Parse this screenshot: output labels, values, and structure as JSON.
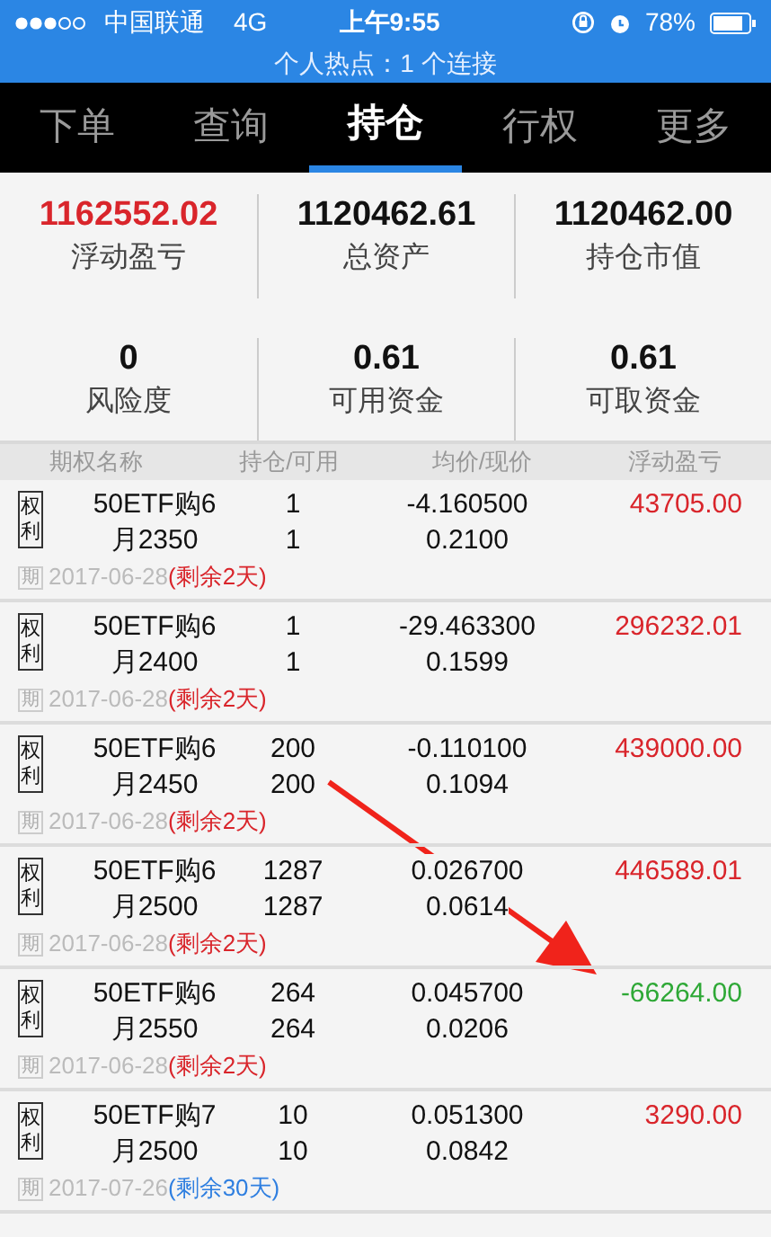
{
  "status_bar": {
    "carrier": "中国联通",
    "network": "4G",
    "time": "上午9:55",
    "battery": "78%",
    "hotspot": "个人热点：1 个连接"
  },
  "tabs": [
    {
      "label": "下单",
      "selected": false
    },
    {
      "label": "查询",
      "selected": false
    },
    {
      "label": "持仓",
      "selected": true
    },
    {
      "label": "行权",
      "selected": false
    },
    {
      "label": "更多",
      "selected": false
    }
  ],
  "summary": [
    {
      "value": "1162552.02",
      "label": "浮动盈亏",
      "color": "#d9252b"
    },
    {
      "value": "1120462.61",
      "label": "总资产",
      "color": "#111111"
    },
    {
      "value": "1120462.00",
      "label": "持仓市值",
      "color": "#111111"
    },
    {
      "value": "0",
      "label": "风险度",
      "color": "#111111"
    },
    {
      "value": "0.61",
      "label": "可用资金",
      "color": "#111111"
    },
    {
      "value": "0.61",
      "label": "可取资金",
      "color": "#111111"
    }
  ],
  "table": {
    "columns": [
      "期权名称",
      "持仓/可用",
      "均价/现价",
      "浮动盈亏"
    ],
    "rows": [
      {
        "badge": "权利",
        "name": [
          "50ETF购6",
          "月2350"
        ],
        "holding": "1",
        "available": "1",
        "avg_price": "-4.160500",
        "cur_price": "0.2100",
        "pnl": {
          "text": "43705.00",
          "color": "#d9252b"
        },
        "expiry_badge": "期",
        "date": "2017-06-28",
        "remaining": {
          "text": "(剩余2天)",
          "color": "#d9252b"
        }
      },
      {
        "badge": "权利",
        "name": [
          "50ETF购6",
          "月2400"
        ],
        "holding": "1",
        "available": "1",
        "avg_price": "-29.463300",
        "cur_price": "0.1599",
        "pnl": {
          "text": "296232.01",
          "color": "#d9252b"
        },
        "expiry_badge": "期",
        "date": "2017-06-28",
        "remaining": {
          "text": "(剩余2天)",
          "color": "#d9252b"
        }
      },
      {
        "badge": "权利",
        "name": [
          "50ETF购6",
          "月2450"
        ],
        "holding": "200",
        "available": "200",
        "avg_price": "-0.110100",
        "cur_price": "0.1094",
        "pnl": {
          "text": "439000.00",
          "color": "#d9252b"
        },
        "expiry_badge": "期",
        "date": "2017-06-28",
        "remaining": {
          "text": "(剩余2天)",
          "color": "#d9252b"
        }
      },
      {
        "badge": "权利",
        "name": [
          "50ETF购6",
          "月2500"
        ],
        "holding": "1287",
        "available": "1287",
        "avg_price": "0.026700",
        "cur_price": "0.0614",
        "pnl": {
          "text": "446589.01",
          "color": "#d9252b"
        },
        "expiry_badge": "期",
        "date": "2017-06-28",
        "remaining": {
          "text": "(剩余2天)",
          "color": "#d9252b"
        }
      },
      {
        "badge": "权利",
        "name": [
          "50ETF购6",
          "月2550"
        ],
        "holding": "264",
        "available": "264",
        "avg_price": "0.045700",
        "cur_price": "0.0206",
        "pnl": {
          "text": "-66264.00",
          "color": "#2ea836"
        },
        "expiry_badge": "期",
        "date": "2017-06-28",
        "remaining": {
          "text": "(剩余2天)",
          "color": "#d9252b"
        }
      },
      {
        "badge": "权利",
        "name": [
          "50ETF购7",
          "月2500"
        ],
        "holding": "10",
        "available": "10",
        "avg_price": "0.051300",
        "cur_price": "0.0842",
        "pnl": {
          "text": "3290.00",
          "color": "#d9252b"
        },
        "expiry_badge": "期",
        "date": "2017-07-26",
        "remaining": {
          "text": "(剩余30天)",
          "color": "#2f7fe0"
        }
      }
    ]
  }
}
